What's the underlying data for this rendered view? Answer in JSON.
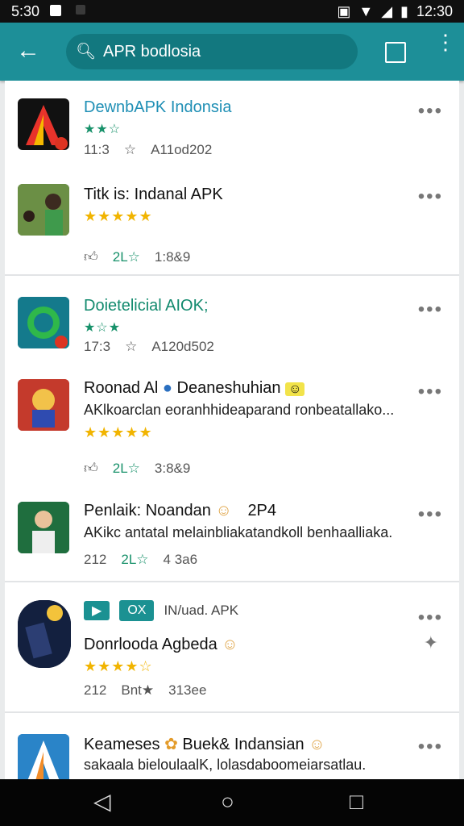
{
  "status": {
    "time": "5:30",
    "clock": "12:30"
  },
  "search": {
    "query": "APR bodlosia"
  },
  "items": [
    {
      "title": "DewnbAPK Indonsia",
      "rating_text": "★★☆",
      "size": "11:3",
      "downloads": "A11od202",
      "color": "#1f8fb5"
    },
    {
      "title": "Titk is: Indanal APK",
      "stars": "★★★★★",
      "likes": "2L☆",
      "count": "1:8&9"
    },
    {
      "title": "Doietelicial AIOK;",
      "rating_text": "★☆★",
      "size": "17:3",
      "downloads": "A120d502",
      "color": "#128a6e"
    },
    {
      "title": "Roonad Al",
      "title2": "Deaneshuhian",
      "desc": "AKlkoarclan eoranhhideaparand ronbeatallako...",
      "stars": "★★★★★",
      "likes": "2L☆",
      "count": "3:8&9"
    },
    {
      "title": "Penlaik: Noandan",
      "title2": "2P4",
      "desc": "AKikc antatal melainbliakatandkoll benhaalliaka.",
      "size": "212",
      "likes": "2L☆",
      "count": "4 3a6"
    },
    {
      "chip1": "▶",
      "chip2": "OX",
      "tag": "IN/uad. APK",
      "title": "Donrlooda Agbeda",
      "stars": "★★★★☆",
      "size": "212",
      "likes": "Bnt★",
      "count": "313ee"
    },
    {
      "title": "Keameses",
      "title2": "Buek& Indansian",
      "desc": "sakaala bieloulaalK, lolasdaboomeiarsatlau."
    }
  ]
}
